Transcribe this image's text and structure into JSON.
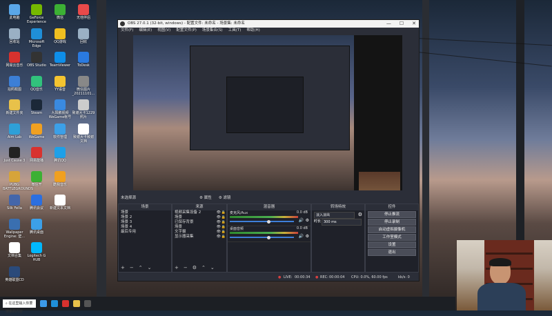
{
  "desktop": {
    "icons": [
      {
        "label": "此电脑",
        "icon": "computer-icon",
        "color": "#5aa7e8"
      },
      {
        "label": "回收站",
        "icon": "recycle-bin-icon",
        "color": "#9ab0c4"
      },
      {
        "label": "网易云音乐",
        "icon": "music-icon",
        "color": "#d8322e"
      },
      {
        "label": "拍照截图",
        "icon": "camera-icon",
        "color": "#3c7fd6"
      },
      {
        "label": "新建文件夹",
        "icon": "folder-icon",
        "color": "#e8c14a"
      },
      {
        "label": "Aim Lab",
        "icon": "target-icon",
        "color": "#2ea0d8"
      },
      {
        "label": "Just Cause 3",
        "icon": "game-icon",
        "color": "#222222"
      },
      {
        "label": "PUBG BATTLEGROUNDS",
        "icon": "game-icon",
        "color": "#d6a43a"
      },
      {
        "label": "Silk Fella",
        "icon": "game-icon",
        "color": "#4466aa"
      },
      {
        "label": "Wallpaper Engine: 壁...",
        "icon": "wallpaper-icon",
        "color": "#3a6fb0"
      },
      {
        "label": "文档合集",
        "icon": "document-icon",
        "color": "#ffffff"
      },
      {
        "label": "英雄联盟CD",
        "icon": "game-icon",
        "color": "#2a4a7a"
      },
      {
        "label": "GeForce Experience",
        "icon": "nvidia-icon",
        "color": "#76b900"
      },
      {
        "label": "Microsoft Edge",
        "icon": "edge-icon",
        "color": "#1f8fd8"
      },
      {
        "label": "OBS Studio",
        "icon": "obs-icon",
        "color": "#333333"
      },
      {
        "label": "QQ音乐",
        "icon": "music-icon",
        "color": "#31c27c"
      },
      {
        "label": "Steam",
        "icon": "steam-icon",
        "color": "#1b2838"
      },
      {
        "label": "WeGame",
        "icon": "wegame-icon",
        "color": "#f0a020"
      },
      {
        "label": "网易能播",
        "icon": "app-icon",
        "color": "#d8322e"
      },
      {
        "label": "微信开",
        "icon": "app-icon",
        "color": "#3cb034"
      },
      {
        "label": "腾讯会议",
        "icon": "meeting-icon",
        "color": "#2b6fe0"
      },
      {
        "label": "腾讯桌面",
        "icon": "desktop-icon",
        "color": "#3ca0e8"
      },
      {
        "label": "Logitech G HUB",
        "icon": "logitech-icon",
        "color": "#00b8fc"
      },
      {
        "label": "微信",
        "icon": "wechat-icon",
        "color": "#3cb034"
      },
      {
        "label": "QQ游戏",
        "icon": "qq-icon",
        "color": "#f0c020"
      },
      {
        "label": "TeamViewer",
        "icon": "teamviewer-icon",
        "color": "#0e8ee9"
      },
      {
        "label": "YY语音",
        "icon": "yy-icon",
        "color": "#f4c430"
      },
      {
        "label": "九阳鹏视频WeGame帐号",
        "icon": "app-icon",
        "color": "#3a8ae0"
      },
      {
        "label": "软件管理",
        "icon": "software-icon",
        "color": "#3ca0e8"
      },
      {
        "label": "腾讯QQ",
        "icon": "qq-icon",
        "color": "#1ea0e8"
      },
      {
        "label": "酷我音乐",
        "icon": "music-icon",
        "color": "#f0a020"
      },
      {
        "label": "新建文本文档",
        "icon": "text-file-icon",
        "color": "#ffffff"
      },
      {
        "label": "无他伴侣",
        "icon": "app-icon",
        "color": "#e84a4a"
      },
      {
        "label": "回收",
        "icon": "recycle-bin-icon",
        "color": "#9ab0c4"
      },
      {
        "label": "ToDesk",
        "icon": "todesk-icon",
        "color": "#2a7ae0"
      },
      {
        "label": "微信图片_20211101...",
        "icon": "image-icon",
        "color": "#888888"
      },
      {
        "label": "致谢大卡1229照片",
        "icon": "image-icon",
        "color": "#cccccc"
      },
      {
        "label": "致谢大卡致谢文档",
        "icon": "document-icon",
        "color": "#ffffff"
      }
    ]
  },
  "taskbar": {
    "search_placeholder": "在这里输入你要搜索的内容",
    "apps": [
      {
        "icon": "windows-start-icon",
        "color": "#3c9ae8"
      },
      {
        "icon": "edge-icon",
        "color": "#1f8fd8"
      },
      {
        "icon": "netease-icon",
        "color": "#d8322e"
      },
      {
        "icon": "file-explorer-icon",
        "color": "#e8c14a"
      },
      {
        "icon": "obs-icon",
        "color": "#555555"
      }
    ]
  },
  "obs": {
    "title": "OBS 27.0.1 (32-bit, windows) - 配置文件: 未命名 - 场景集: 未命名",
    "window_controls": {
      "minimize": "—",
      "maximize": "☐",
      "close": "✕"
    },
    "menu": [
      "文件(F)",
      "编辑(E)",
      "视图(V)",
      "配置文件(P)",
      "场景集合(S)",
      "工具(T)",
      "帮助(H)"
    ],
    "source_toolbar": {
      "no_source": "未选择源",
      "properties": "属性",
      "filters": "滤镜"
    },
    "scenes": {
      "title": "场景",
      "items": [
        "场景",
        "场景 2",
        "场景 3",
        "场景 4",
        "最后专用"
      ]
    },
    "sources": {
      "title": "来源",
      "items": [
        "视频采集设备 2",
        "场景",
        "已保存背景",
        "场景",
        "文字摄",
        "显示器采集"
      ]
    },
    "mixer": {
      "title": "混音器",
      "channels": [
        {
          "name": "麦克风/Aux",
          "db": "0.0 dB",
          "level": 0.6
        },
        {
          "name": "桌面音频",
          "db": "0.0 dB",
          "level": 0.6
        }
      ]
    },
    "transitions": {
      "title": "转场特效",
      "type": "淡入淡出",
      "duration_label": "时长",
      "duration": "300 ms"
    },
    "controls": {
      "title": "控件",
      "buttons": [
        "停止推流",
        "停止录制",
        "启动虚拟摄像机",
        "工作室模式",
        "设置",
        "退出"
      ]
    },
    "status": {
      "live_label": "LIVE:",
      "live_time": "00:00:34",
      "rec_label": "REC:",
      "rec_time": "00:00:04",
      "cpu": "CPU: 0.0%, 60.00 fps",
      "kbps": "kb/s: 0"
    }
  },
  "colors": {
    "obs_bg": "#2b2e38",
    "dock_bg": "#1f2129",
    "accent": "#3e7fd9",
    "live_red": "#d84040"
  }
}
